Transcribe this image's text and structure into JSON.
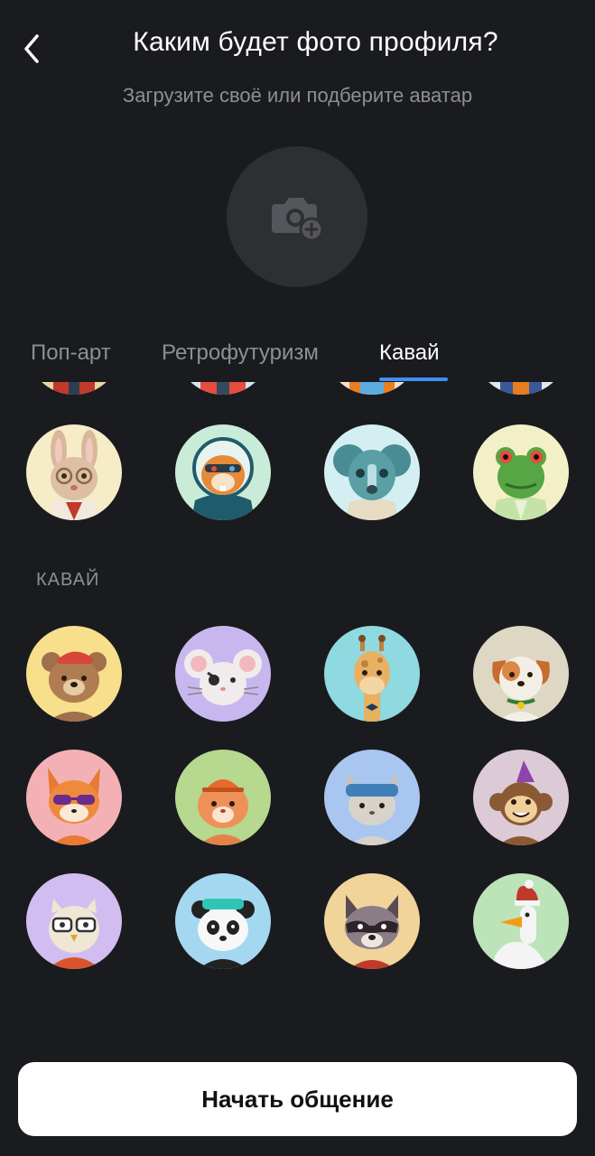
{
  "header": {
    "title": "Каким будет фото профиля?",
    "subtitle": "Загрузите своё или подберите аватар"
  },
  "upload": {
    "icon": "camera-plus-icon"
  },
  "tabs": [
    {
      "label": "Поп-арт",
      "active": false
    },
    {
      "label": "Ретрофутуризм",
      "active": false
    },
    {
      "label": "Кавай",
      "active": true
    }
  ],
  "accent_color": "#3f8ff7",
  "sections": {
    "retro": {
      "avatars": [
        {
          "name": "rabbit",
          "bg": "#f7ecc8"
        },
        {
          "name": "hamster-astronaut",
          "bg": "#c9ecd9"
        },
        {
          "name": "koala-robot",
          "bg": "#d3eff2"
        },
        {
          "name": "frog",
          "bg": "#f3f0c7"
        }
      ]
    },
    "kawaii": {
      "label": "КАВАЙ",
      "avatars": [
        {
          "name": "bear",
          "bg": "#f7df8c"
        },
        {
          "name": "mouse",
          "bg": "#c8b7ef"
        },
        {
          "name": "giraffe",
          "bg": "#8fd9e0"
        },
        {
          "name": "puppy",
          "bg": "#ddd7c4"
        },
        {
          "name": "fox",
          "bg": "#f3b1b6"
        },
        {
          "name": "hamster",
          "bg": "#b6d88f"
        },
        {
          "name": "cat",
          "bg": "#a9c6f1"
        },
        {
          "name": "monkey",
          "bg": "#dccbd7"
        },
        {
          "name": "owl",
          "bg": "#d2bdf0"
        },
        {
          "name": "panda",
          "bg": "#a4d8f1"
        },
        {
          "name": "raccoon",
          "bg": "#f0d49a"
        },
        {
          "name": "goose",
          "bg": "#bde3b9"
        }
      ]
    }
  },
  "cta": {
    "label": "Начать общение"
  }
}
